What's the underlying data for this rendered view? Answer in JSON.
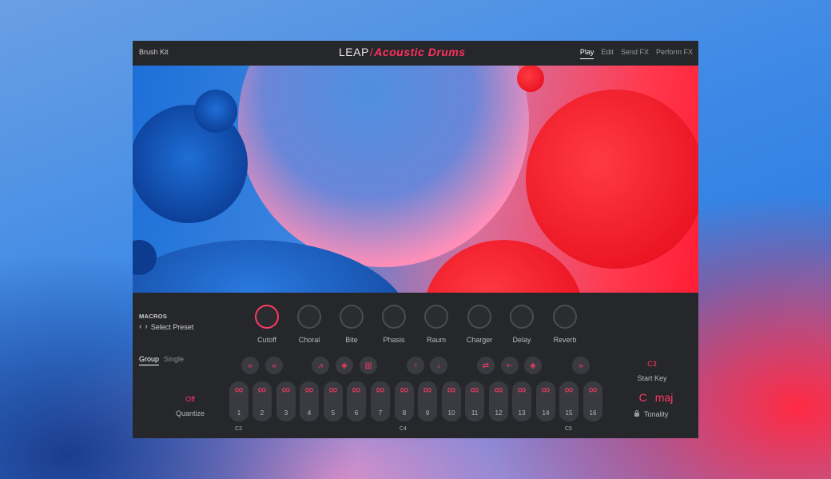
{
  "header": {
    "preset_name": "Brush Kit",
    "logo_leap": "LEAP",
    "logo_slash": "/",
    "logo_product": "Acoustic Drums",
    "tabs": [
      {
        "label": "Play",
        "active": true
      },
      {
        "label": "Edit",
        "active": false
      },
      {
        "label": "Send FX",
        "active": false
      },
      {
        "label": "Perform FX",
        "active": false
      }
    ]
  },
  "macros": {
    "title": "MACROS",
    "prev_arrow": "‹",
    "next_arrow": "›",
    "select_preset": "Select Preset",
    "knobs": [
      "Cutoff",
      "Choral",
      "Bite",
      "Phasis",
      "Raum",
      "Charger",
      "Delay",
      "Reverb"
    ]
  },
  "mode_tabs": {
    "group": "Group",
    "single": "Single",
    "active": "Group"
  },
  "quantize": {
    "value": "Off",
    "label": "Quantize"
  },
  "actions": [
    {
      "icon": "fast-forward-icon",
      "glyph": "»"
    },
    {
      "icon": "rewind-icon",
      "glyph": "«"
    },
    {
      "icon": "envelope-icon",
      "glyph": "⩘"
    },
    {
      "icon": "diamond-grid-icon",
      "glyph": "◈"
    },
    {
      "icon": "bars-icon",
      "glyph": "▥"
    },
    {
      "icon": "arrow-up-icon",
      "glyph": "↑"
    },
    {
      "icon": "arrow-down-icon",
      "glyph": "↓"
    },
    {
      "icon": "swap-icon",
      "glyph": "⇄"
    },
    {
      "icon": "reverse-icon",
      "glyph": "⇠"
    },
    {
      "icon": "diamond-icon",
      "glyph": "◈"
    },
    {
      "icon": "fast-forward-icon",
      "glyph": "»"
    }
  ],
  "pads": [
    "1",
    "2",
    "3",
    "4",
    "5",
    "6",
    "7",
    "8",
    "9",
    "10",
    "11",
    "12",
    "13",
    "14",
    "15",
    "16"
  ],
  "pad_glyph": "∞",
  "octave_labels": [
    "C3",
    "C4",
    "C5"
  ],
  "start_key": {
    "value": "C3",
    "label": "Start Key"
  },
  "tonality": {
    "root": "C",
    "scale": "maj",
    "label": "Tonality"
  },
  "colors": {
    "accent": "#ff3a66",
    "panel": "#26272b",
    "pad": "#3a3b40"
  }
}
